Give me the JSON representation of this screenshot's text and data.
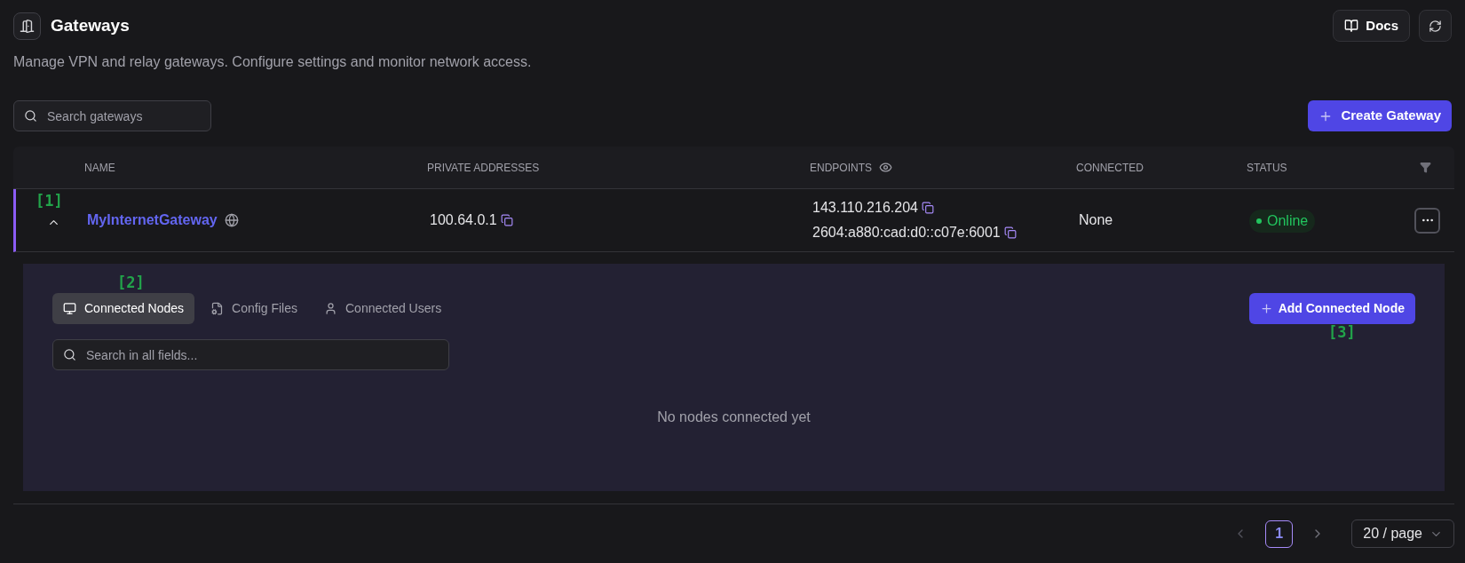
{
  "header": {
    "title": "Gateways",
    "subtitle": "Manage VPN and relay gateways. Configure settings and monitor network access.",
    "docs_button": "Docs"
  },
  "search": {
    "placeholder": "Search gateways"
  },
  "create_button": "Create Gateway",
  "table": {
    "columns": [
      {
        "label": "NAME"
      },
      {
        "label": "PRIVATE ADDRESSES"
      },
      {
        "label": "ENDPOINTS"
      },
      {
        "label": "CONNECTED"
      },
      {
        "label": "STATUS"
      }
    ],
    "rows": [
      {
        "expanded": true,
        "name": "MyInternetGateway",
        "private_addresses": [
          "100.64.0.1"
        ],
        "endpoints": [
          "143.110.216.204",
          "2604:a880:cad:d0::c07e:6001"
        ],
        "connected": "None",
        "status": "Online",
        "detail": {
          "tabs": [
            {
              "label": "Connected Nodes",
              "selected": true
            },
            {
              "label": "Config Files",
              "selected": false
            },
            {
              "label": "Connected Users",
              "selected": false
            }
          ],
          "add_button": "Add Connected Node",
          "search_placeholder": "Search in all fields...",
          "empty_text": "No nodes connected yet"
        }
      }
    ]
  },
  "pagination": {
    "pages": [
      {
        "label": "1",
        "selected": true
      }
    ],
    "page_size": "20 / page"
  },
  "annotations": [
    "[1]",
    "[2]",
    "[3]"
  ]
}
